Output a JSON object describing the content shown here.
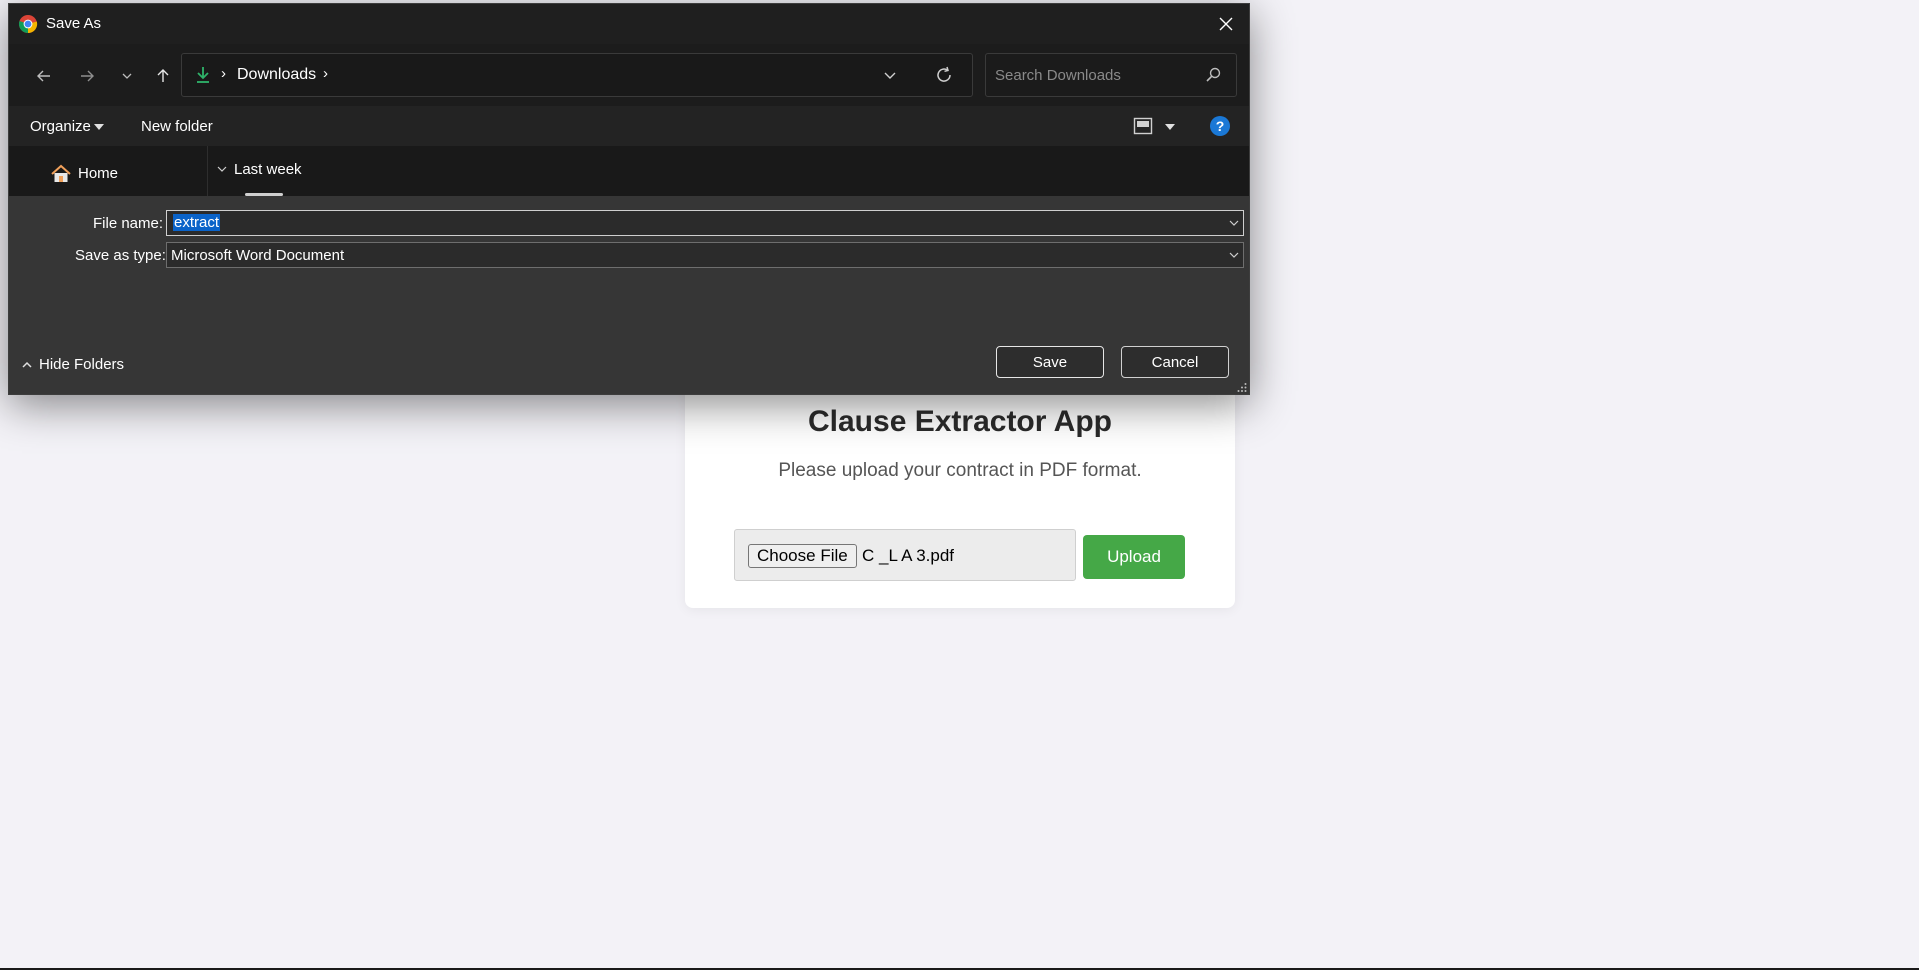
{
  "dialog": {
    "title": "Save As",
    "address": {
      "location": "Downloads",
      "separator": "›"
    },
    "search": {
      "placeholder": "Search Downloads"
    },
    "command_bar": {
      "organize": "Organize",
      "new_folder": "New folder"
    },
    "nav_pane": {
      "home": "Home"
    },
    "file_pane": {
      "group_label": "Last week"
    },
    "file_name": {
      "label": "File name:",
      "value": "extract"
    },
    "save_as_type": {
      "label": "Save as type:",
      "value": "Microsoft Word Document"
    },
    "hide_folders": "Hide Folders",
    "buttons": {
      "save": "Save",
      "cancel": "Cancel"
    }
  },
  "page": {
    "title": "Clause Extractor App",
    "subtitle": "Please upload your contract in PDF format.",
    "file_input": {
      "button": "Choose File",
      "selected": "C _L A 3.pdf"
    },
    "upload_button": "Upload",
    "colors": {
      "upload": "#45a847",
      "background": "#f3f2f7",
      "help": "#1a78d6",
      "download_arrow": "#2fb36a",
      "home_roof": "#f0a05a"
    }
  }
}
